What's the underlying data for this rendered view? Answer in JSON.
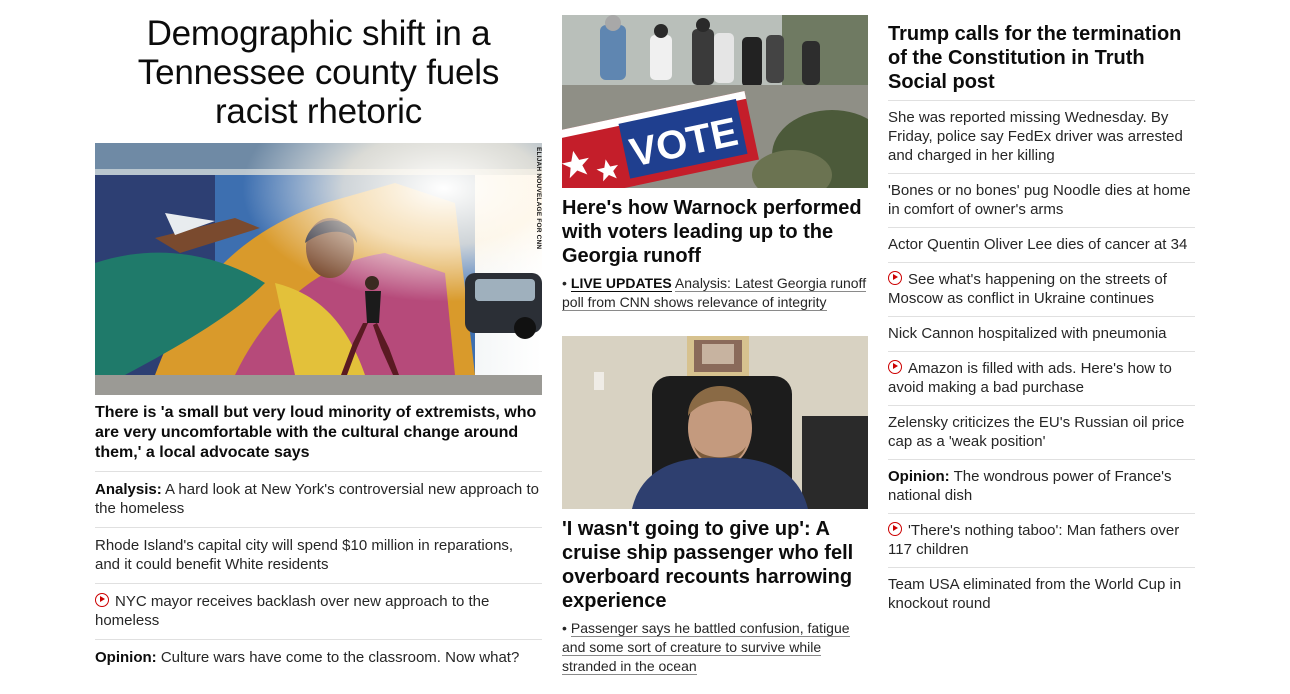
{
  "column1": {
    "headline": "Demographic shift in a Tennessee county fuels racist rhetoric",
    "photo_credit": "ELIJAH NOUVELAGE FOR CNN",
    "dek": "There is 'a small but very loud minority of extremists, who are very uncomfortable with the cultural change around them,' a local advocate says",
    "items": [
      {
        "prefix": "Analysis:",
        "text": "A hard look at New York's controversial new approach to the homeless",
        "video": false
      },
      {
        "prefix": "",
        "text": "Rhode Island's capital city will spend $10 million in reparations, and it could benefit White residents",
        "video": false
      },
      {
        "prefix": "",
        "text": "NYC mayor receives backlash over new approach to the homeless",
        "video": true
      },
      {
        "prefix": "Opinion:",
        "text": "Culture wars have come to the classroom. Now what?",
        "video": false
      }
    ]
  },
  "column2": {
    "story1": {
      "headline": "Here's how Warnock performed with voters leading up to the Georgia runoff",
      "bullet": "•",
      "live_label": "LIVE UPDATES",
      "sub": "Analysis: Latest Georgia runoff poll from CNN shows relevance of integrity",
      "sign_text": "VOTE"
    },
    "story2": {
      "headline": "'I wasn't going to give up': A cruise ship passenger who fell overboard recounts harrowing experience",
      "bullet": "•",
      "sub": "Passenger says he battled confusion, fatigue and some sort of creature to survive while stranded in the ocean"
    }
  },
  "column3": {
    "headline": "Trump calls for the termination of the Constitution in Truth Social post",
    "items": [
      {
        "prefix": "",
        "text": "She was reported missing Wednesday. By Friday, police say FedEx driver was arrested and charged in her killing",
        "video": false
      },
      {
        "prefix": "",
        "text": "'Bones or no bones' pug Noodle dies at home in comfort of owner's arms",
        "video": false
      },
      {
        "prefix": "",
        "text": "Actor Quentin Oliver Lee dies of cancer at 34",
        "video": false
      },
      {
        "prefix": "",
        "text": "See what's happening on the streets of Moscow as conflict in Ukraine continues",
        "video": true
      },
      {
        "prefix": "",
        "text": "Nick Cannon hospitalized with pneumonia",
        "video": false
      },
      {
        "prefix": "",
        "text": "Amazon is filled with ads. Here's how to avoid making a bad purchase",
        "video": true
      },
      {
        "prefix": "",
        "text": "Zelensky criticizes the EU's Russian oil price cap as a 'weak position'",
        "video": false
      },
      {
        "prefix": "Opinion:",
        "text": "The wondrous power of France's national dish",
        "video": false
      },
      {
        "prefix": "",
        "text": "'There's nothing taboo': Man fathers over 117 children",
        "video": true
      },
      {
        "prefix": "",
        "text": "Team USA eliminated from the World Cup in knockout round",
        "video": false
      }
    ]
  }
}
